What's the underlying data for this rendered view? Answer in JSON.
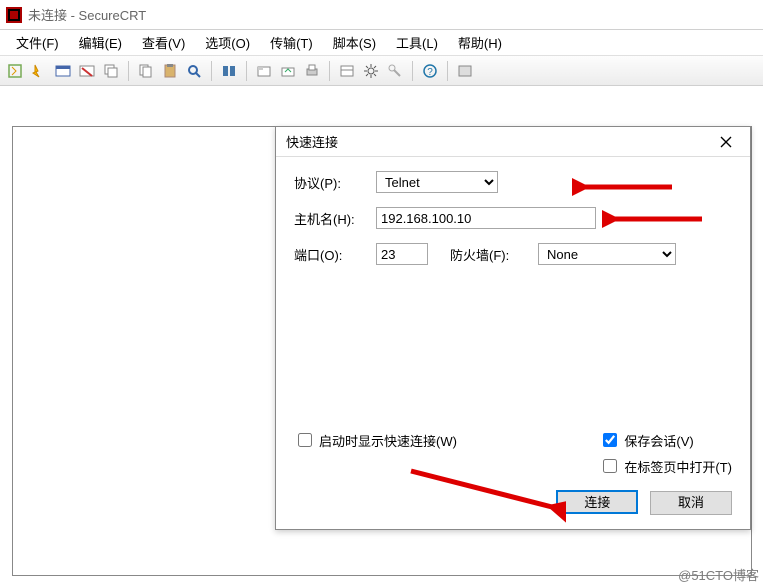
{
  "window": {
    "title": "未连接 - SecureCRT"
  },
  "menu": {
    "items": [
      "文件(F)",
      "编辑(E)",
      "查看(V)",
      "选项(O)",
      "传输(T)",
      "脚本(S)",
      "工具(L)",
      "帮助(H)"
    ]
  },
  "dialog": {
    "title": "快速连接",
    "protocol_label": "协议(P):",
    "protocol_value": "Telnet",
    "host_label": "主机名(H):",
    "host_value": "192.168.100.10",
    "port_label": "端口(O):",
    "port_value": "23",
    "firewall_label": "防火墙(F):",
    "firewall_value": "None",
    "chk_quick": "启动时显示快速连接(W)",
    "chk_save": "保存会话(V)",
    "chk_tab": "在标签页中打开(T)",
    "btn_connect": "连接",
    "btn_cancel": "取消"
  },
  "watermark": "@51CTO博客"
}
